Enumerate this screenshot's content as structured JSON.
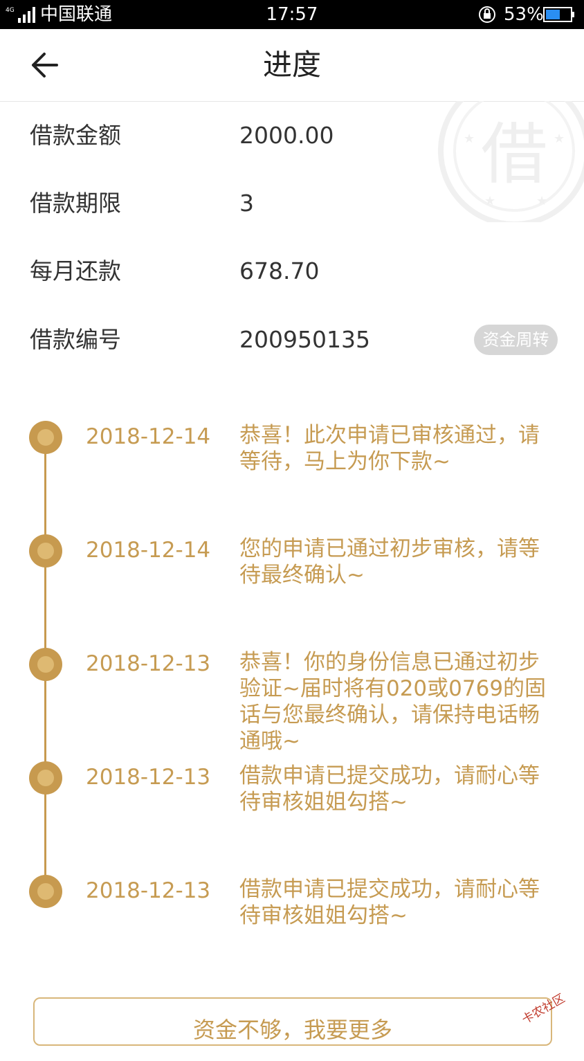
{
  "status_bar": {
    "network": "4G",
    "carrier": "中国联通",
    "time": "17:57",
    "battery_pct": "53%"
  },
  "header": {
    "title": "进度"
  },
  "info": {
    "rows": [
      {
        "label": "借款金额",
        "value": "2000.00"
      },
      {
        "label": "借款期限",
        "value": "3"
      },
      {
        "label": "每月还款",
        "value": "678.70"
      },
      {
        "label": "借款编号",
        "value": "200950135"
      }
    ],
    "tag": "资金周转",
    "stamp_char": "借"
  },
  "timeline": {
    "items": [
      {
        "date": "2018-12-14",
        "text": "恭喜！此次申请已审核通过，请等待，马上为你下款~"
      },
      {
        "date": "2018-12-14",
        "text": "您的申请已通过初步审核，请等待最终确认~"
      },
      {
        "date": "2018-12-13",
        "text": "恭喜！你的身份信息已通过初步验证~届时将有020或0769的固话与您最终确认，请保持电话畅通哦~"
      },
      {
        "date": "2018-12-13",
        "text": "借款申请已提交成功，请耐心等待审核姐姐勾搭~"
      },
      {
        "date": "2018-12-13",
        "text": "借款申请已提交成功，请耐心等待审核姐姐勾搭~"
      }
    ]
  },
  "bottom": {
    "button_label": "资金不够，我要更多"
  },
  "watermark": {
    "text": "卡农社区"
  },
  "colors": {
    "accent": "#c69b52",
    "tag_bg": "#d6d6d6",
    "status_bar_bg": "#000000"
  }
}
